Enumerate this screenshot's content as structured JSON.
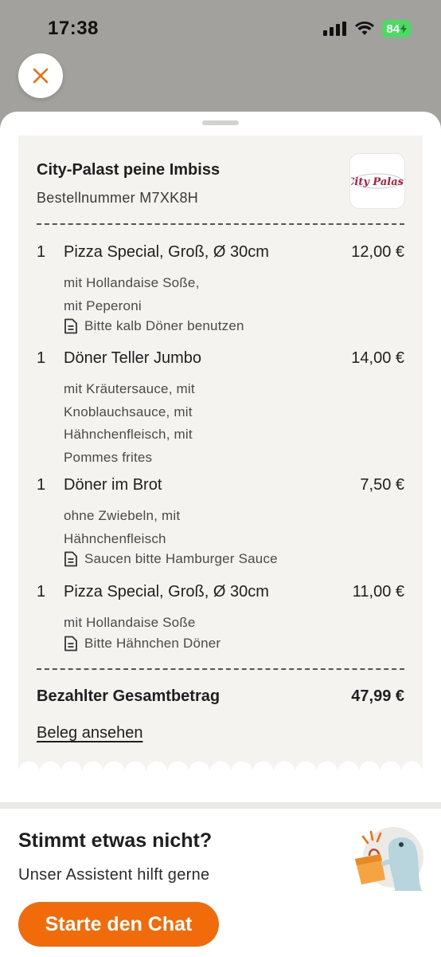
{
  "status_bar": {
    "time": "17:38",
    "battery": "84"
  },
  "restaurant": {
    "name": "City-Palast peine Imbiss",
    "logo_text": "City Palast"
  },
  "order": {
    "number_label": "Bestellnummer M7XK8H"
  },
  "items": [
    {
      "qty": "1",
      "name": "Pizza Special, Groß, Ø 30cm",
      "price": "12,00 €",
      "options": [
        "mit Hollandaise Soße,",
        "mit Peperoni"
      ],
      "note": "Bitte kalb Döner benutzen"
    },
    {
      "qty": "1",
      "name": "Döner Teller Jumbo",
      "price": "14,00 €",
      "options": [
        "mit Kräutersauce, mit",
        "Knoblauchsauce, mit",
        "Hähnchenfleisch, mit",
        "Pommes frites"
      ],
      "note": ""
    },
    {
      "qty": "1",
      "name": "Döner im Brot",
      "price": "7,50 €",
      "options": [
        "ohne Zwiebeln, mit",
        "Hähnchenfleisch"
      ],
      "note": "Saucen bitte Hamburger Sauce"
    },
    {
      "qty": "1",
      "name": "Pizza Special, Groß, Ø 30cm",
      "price": "11,00 €",
      "options": [
        "mit Hollandaise Soße"
      ],
      "note": "Bitte Hähnchen Döner"
    }
  ],
  "total": {
    "label": "Bezahlter Gesamtbetrag",
    "value": "47,99 €"
  },
  "receipt_link": "Beleg ansehen",
  "help": {
    "title": "Stimmt etwas nicht?",
    "subtitle": "Unser Assistent hilft gerne",
    "button": "Starte den Chat"
  },
  "colors": {
    "accent": "#f26b0a",
    "receipt_bg": "#f5f3f0",
    "overlay": "#a3a19d"
  },
  "icons": {
    "close": "close-icon",
    "note": "note-icon"
  }
}
